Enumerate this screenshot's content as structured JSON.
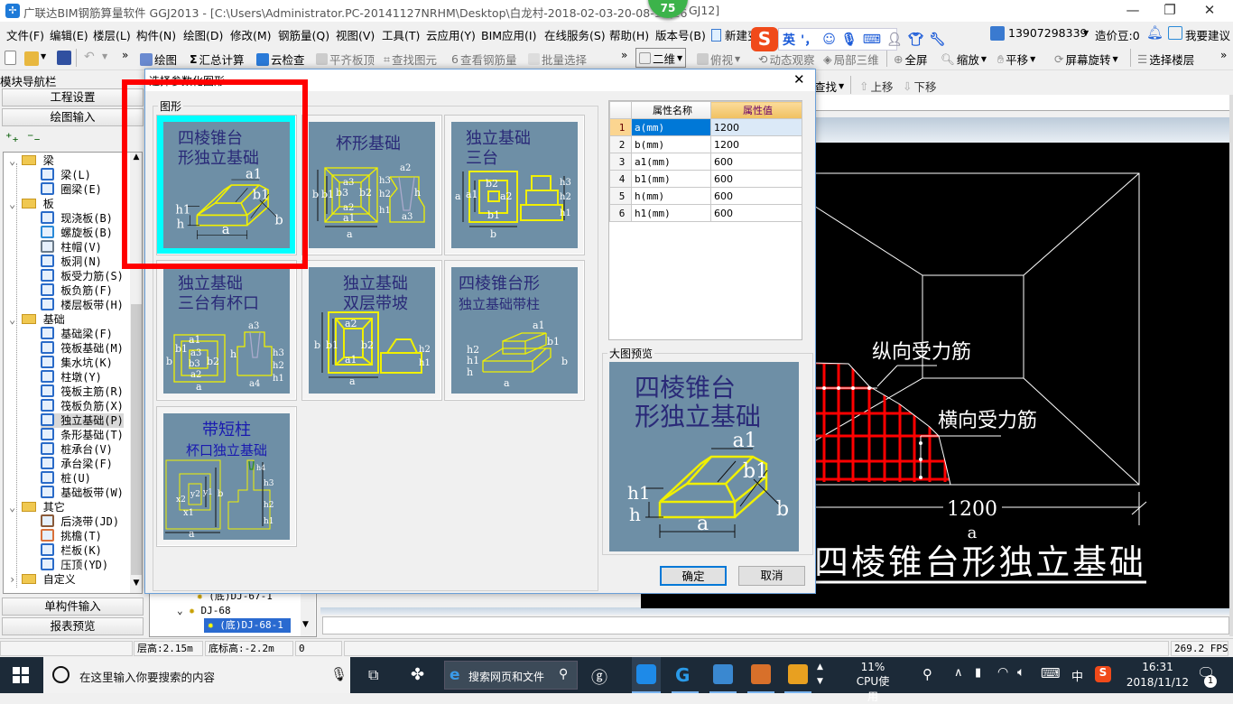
{
  "window": {
    "title": "广联达BIM钢筋算量软件 GGJ2013 - [C:\\Users\\Administrator.PC-20141127NRHM\\Desktop\\白龙村-2018-02-03-20-08-17(26",
    "title_tail": "GJ12]",
    "badge": "75",
    "minimize": "—",
    "restore": "❐",
    "close": "✕"
  },
  "menu": [
    "文件(F)",
    "编辑(E)",
    "楼层(L)",
    "构件(N)",
    "绘图(D)",
    "修改(M)",
    "钢筋量(Q)",
    "视图(V)",
    "工具(T)",
    "云应用(Y)",
    "BIM应用(I)",
    "在线服务(S)",
    "帮助(H)",
    "版本号(B)"
  ],
  "menu_new_change": "新建变更",
  "account": {
    "phone": "13907298339",
    "beans": "造价豆:0",
    "suggest": "我要建议"
  },
  "ime": {
    "logo": "S",
    "lang": "英",
    "punct": "'，"
  },
  "toolbar": {
    "draw": "绘图",
    "sum": "汇总计算",
    "cloud_check": "云检查",
    "align_top": "平齐板顶",
    "find": "查找图元",
    "view_rebar": "查看钢筋量",
    "batch": "批量选择",
    "more": "»",
    "view2d": "二维",
    "top_view": "俯视",
    "orbit": "动态观察",
    "local3d": "局部三维",
    "fullscreen": "全屏",
    "zoom": "缩放",
    "pan": "平移",
    "rotate": "屏幕旋转",
    "select_floor": "选择楼层"
  },
  "toolbar2": {
    "find": "查找",
    "up": "上移",
    "down": "下移"
  },
  "nav": {
    "title": "模块导航栏",
    "pin": "ᵽ ×",
    "project": "工程设置",
    "draw_input": "绘图输入",
    "single": "单构件输入",
    "report": "报表预览"
  },
  "tree": [
    {
      "label": "梁",
      "folder": true,
      "open": true
    },
    {
      "label": "梁(L)",
      "color": "#2a6bc8"
    },
    {
      "label": "圈梁(E)",
      "color": "#2a6bc8"
    },
    {
      "label": "板",
      "folder": true,
      "open": true
    },
    {
      "label": "现浇板(B)",
      "color": "#2a6bc8"
    },
    {
      "label": "螺旋板(B)",
      "color": "#2a8ad8"
    },
    {
      "label": "柱帽(V)",
      "color": "#6a7a8a"
    },
    {
      "label": "板洞(N)",
      "color": "#2a6bc8"
    },
    {
      "label": "板受力筋(S)",
      "color": "#2a6bc8"
    },
    {
      "label": "板负筋(F)",
      "color": "#2a6bc8"
    },
    {
      "label": "楼层板带(H)",
      "color": "#2a6bc8"
    },
    {
      "label": "基础",
      "folder": true,
      "open": true
    },
    {
      "label": "基础梁(F)",
      "color": "#2a6bc8"
    },
    {
      "label": "筏板基础(M)",
      "color": "#2a6bc8"
    },
    {
      "label": "集水坑(K)",
      "color": "#2a6bc8"
    },
    {
      "label": "柱墩(Y)",
      "color": "#2a6bc8"
    },
    {
      "label": "筏板主筋(R)",
      "color": "#2a6bc8"
    },
    {
      "label": "筏板负筋(X)",
      "color": "#2a6bc8"
    },
    {
      "label": "独立基础(P)",
      "color": "#2a6bc8",
      "selected": true
    },
    {
      "label": "条形基础(T)",
      "color": "#2a6bc8"
    },
    {
      "label": "桩承台(V)",
      "color": "#2a6bc8"
    },
    {
      "label": "承台梁(F)",
      "color": "#2a6bc8"
    },
    {
      "label": "桩(U)",
      "color": "#2a6bc8"
    },
    {
      "label": "基础板带(W)",
      "color": "#2a6bc8"
    },
    {
      "label": "其它",
      "folder": true,
      "open": true
    },
    {
      "label": "后浇带(JD)",
      "color": "#8a5a3a"
    },
    {
      "label": "挑檐(T)",
      "color": "#d8703a"
    },
    {
      "label": "栏板(K)",
      "color": "#2a6bc8"
    },
    {
      "label": "压顶(YD)",
      "color": "#2a6bc8"
    },
    {
      "label": "自定义",
      "folder": true,
      "open": false
    }
  ],
  "panel2": {
    "items": [
      "(底)DJ-67-1",
      "DJ-68",
      "(底)DJ-68-1"
    ]
  },
  "status": {
    "floor_height": "层高:2.15m",
    "base_elev": "底标高:-2.2m",
    "value": "0",
    "fps": "269.2 FPS"
  },
  "dialog": {
    "title": "选择参数化图形",
    "close": "✕",
    "group_shapes": "图形",
    "group_preview": "大图预览",
    "ok": "确定",
    "cancel": "取消",
    "thumbs": [
      {
        "title": [
          "四棱锥台",
          "形独立基础"
        ],
        "labels": [
          "a1",
          "b1",
          "h1",
          "h",
          "b",
          "a"
        ],
        "selected": true
      },
      {
        "title": [
          "杯形基础"
        ],
        "labels": [
          "b",
          "b1",
          "b3",
          "b2",
          "a3",
          "a2",
          "a1",
          "a",
          "a2",
          "h3",
          "h2",
          "h1",
          "h",
          "a3"
        ]
      },
      {
        "title": [
          "独立基础",
          "三台"
        ],
        "labels": [
          "a",
          "a1",
          "b2",
          "a2",
          "b1",
          "b",
          "h3",
          "h2",
          "h1"
        ]
      },
      {
        "title": [
          "独立基础",
          "三台有杯口"
        ],
        "labels": [
          "a1",
          "b1",
          "a3",
          "b3",
          "b2",
          "b",
          "a2",
          "a",
          "a3",
          "h",
          "a4",
          "h3",
          "h2",
          "h1"
        ]
      },
      {
        "title": [
          "独立基础",
          "双层带坡"
        ],
        "labels": [
          "b",
          "b1",
          "a2",
          "b2",
          "a1",
          "a",
          "h2",
          "h1"
        ]
      },
      {
        "title": [
          "四棱锥台形",
          "独立基础带柱"
        ],
        "labels": [
          "a1",
          "b1",
          "h2",
          "h1",
          "h",
          "b",
          "a"
        ]
      },
      {
        "title": [
          "带短柱",
          "杯口独立基础"
        ],
        "labels": [
          "x2",
          "y2",
          "y1",
          "b",
          "x1",
          "a",
          "h4",
          "h3",
          "h2",
          "h1"
        ]
      }
    ],
    "preview": {
      "title": [
        "四棱锥台",
        "形独立基础"
      ],
      "labels": [
        "a1",
        "b1",
        "h1",
        "h",
        "b",
        "a"
      ]
    },
    "table": {
      "headers": [
        "属性名称",
        "属性值"
      ],
      "rows": [
        [
          "1",
          "a(mm)",
          "1200"
        ],
        [
          "2",
          "b(mm)",
          "1200"
        ],
        [
          "3",
          "a1(mm)",
          "600"
        ],
        [
          "4",
          "b1(mm)",
          "600"
        ],
        [
          "5",
          "h(mm)",
          "600"
        ],
        [
          "6",
          "h1(mm)",
          "600"
        ]
      ]
    }
  },
  "cad": {
    "label_long": "纵向受力筋",
    "label_trans": "横向受力筋",
    "dim_value": "1200",
    "dim_name": "a",
    "title": "四棱锥台形独立基础"
  },
  "taskbar": {
    "search_placeholder": "在这里输入你要搜索的内容",
    "web_search": "搜索网页和文件",
    "cpu": "11%",
    "cpu_label": "CPU使用",
    "ime": "中",
    "time": "16:31",
    "date": "2018/11/12",
    "notif_count": "1"
  },
  "colors": {
    "thumb_bg": "#6e8fa6",
    "shape": "#f0f000",
    "title_ink": "#2a2a78",
    "selected_border": "#00ffff",
    "highlight": "#ff0000",
    "cad_bg": "#000000",
    "rebar": "#ff0000",
    "selection_blue": "#0078d7"
  }
}
